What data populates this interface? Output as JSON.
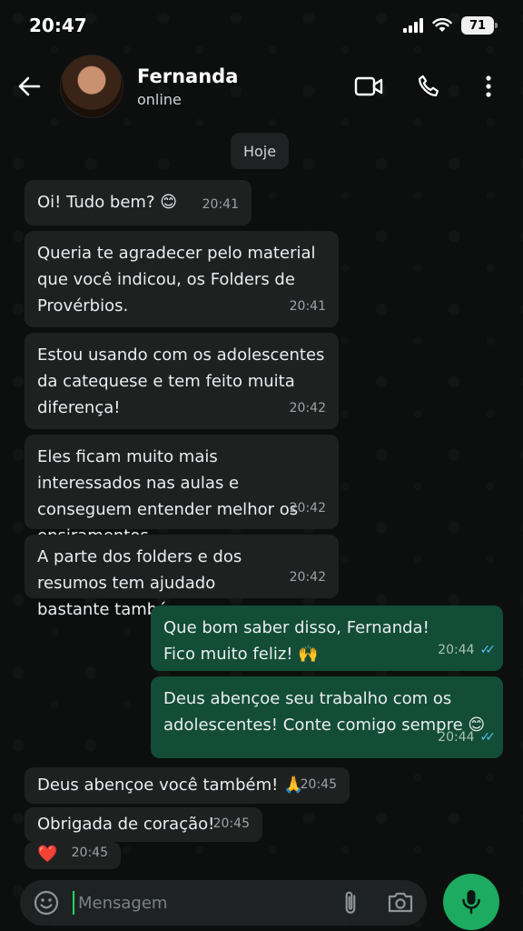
{
  "status_bar": {
    "time": "20:47",
    "battery": "71"
  },
  "header": {
    "name": "Fernanda",
    "status": "online"
  },
  "chat": {
    "date_chip": "Hoje",
    "messages": [
      {
        "dir": "in",
        "text": "Oi! Tudo bem? 😊",
        "time": "20:41"
      },
      {
        "dir": "in",
        "text": "Queria te agradecer pelo material que você indicou, os Folders de Provérbios.",
        "time": "20:41"
      },
      {
        "dir": "in",
        "text": "Estou usando com os adolescentes da catequese e tem feito muita diferença!",
        "time": "20:42"
      },
      {
        "dir": "in",
        "text": "Eles ficam muito mais interessados nas aulas e conseguem entender melhor os ensiramentos.",
        "time": "20:42"
      },
      {
        "dir": "in",
        "text": "A parte dos folders e dos resumos tem ajudado bastante também.",
        "time": "20:42"
      },
      {
        "dir": "out",
        "text": "Que bom saber disso, Fernanda! Fico muito feliz! 🙌",
        "time": "20:44"
      },
      {
        "dir": "out",
        "text": "Deus abençoe seu trabalho com os adolescentes! Conte comigo sempre 😊",
        "time": "20:44"
      },
      {
        "dir": "in",
        "text": "Deus abençoe você também! 🙏",
        "time": "20:45"
      },
      {
        "dir": "in",
        "text": "Obrigada de coração!",
        "time": "20:45"
      },
      {
        "dir": "in",
        "text": "❤️",
        "time": "20:45"
      }
    ]
  },
  "input": {
    "placeholder": "Mensagem"
  },
  "icons": {
    "back": "arrow-left-icon",
    "video": "video-call-icon",
    "call": "phone-icon",
    "menu": "more-vert-icon",
    "emoji": "emoji-icon",
    "attach": "paperclip-icon",
    "camera": "camera-icon",
    "mic": "mic-icon"
  },
  "colors": {
    "incoming": "#1f2121",
    "outgoing": "#134d37",
    "accent": "#1daa61",
    "read_ticks": "#53bdeb"
  }
}
